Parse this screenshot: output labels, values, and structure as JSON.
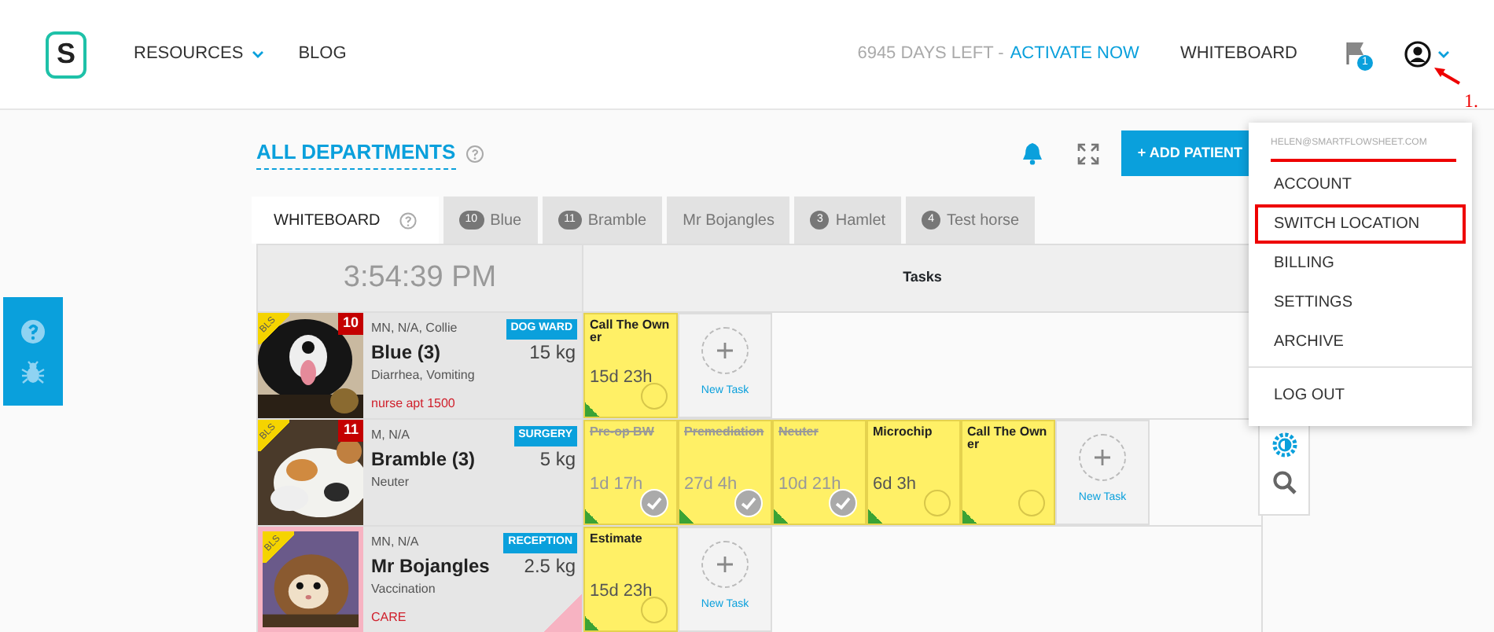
{
  "navbar": {
    "logo": "S",
    "items": [
      {
        "label": "RESOURCES",
        "dropdown": true
      },
      {
        "label": "BLOG",
        "dropdown": false
      }
    ],
    "trial_text": "6945 DAYS LEFT -",
    "trial_link": "ACTIVATE NOW",
    "whiteboard": "WHITEBOARD",
    "flag_count": "1"
  },
  "header": {
    "title": "ALL DEPARTMENTS",
    "add_button": "+ ADD PATIENT"
  },
  "tabs": [
    {
      "label": "WHITEBOARD",
      "selected": true,
      "help": true
    },
    {
      "label": "Blue",
      "count": "10",
      "selected": false
    },
    {
      "label": "Bramble",
      "count": "11",
      "selected": false
    },
    {
      "label": "Mr Bojangles",
      "selected": false
    },
    {
      "label": "Hamlet",
      "count": "3",
      "selected": false
    },
    {
      "label": "Test horse",
      "count": "4",
      "selected": false
    }
  ],
  "board": {
    "clock": "3:54:39 PM",
    "tasks_heading": "Tasks",
    "patients": [
      {
        "number": "10",
        "tag": "BLS",
        "details": "MN, N/A, Collie",
        "name": "Blue (3)",
        "ward": "DOG WARD",
        "weight": "15 kg",
        "problem": "Diarrhea, Vomiting",
        "note": "nurse apt 1500",
        "highlighted": false,
        "new_task": "New Task",
        "tasks": [
          {
            "title": "Call The Owner",
            "due": "15d 23h",
            "done": false
          }
        ]
      },
      {
        "number": "11",
        "tag": "BLS",
        "details": "M, N/A",
        "name": "Bramble (3)",
        "ward": "SURGERY",
        "weight": "5 kg",
        "problem": "Neuter",
        "highlighted": false,
        "new_task": "New Task",
        "tasks": [
          {
            "title": "Pre-op BW",
            "due": "1d 17h",
            "done": true
          },
          {
            "title": "Premediation",
            "due": "27d 4h",
            "done": true
          },
          {
            "title": "Neuter",
            "due": "10d 21h",
            "done": true
          },
          {
            "title": "Microchip",
            "due": "6d 3h",
            "done": false
          },
          {
            "title": "Call The Owner",
            "done": false
          }
        ]
      },
      {
        "tag": "BLS",
        "details": "MN, N/A",
        "name": "Mr Bojangles",
        "ward": "RECEPTION",
        "weight": "2.5 kg",
        "problem": "Vaccination",
        "note": "CARE",
        "highlighted": true,
        "new_task": "New Task",
        "tasks": [
          {
            "title": "Estimate",
            "due": "15d 23h",
            "done": false
          }
        ]
      }
    ]
  },
  "user_menu": {
    "email": "HELEN@SMARTFLOWSHEET.COM",
    "email_marked": true,
    "items": [
      {
        "label": "ACCOUNT",
        "marked": false
      },
      {
        "label": "SWITCH LOCATION",
        "marked": true
      },
      {
        "label": "BILLING",
        "marked": false
      },
      {
        "label": "SETTINGS",
        "marked": false
      },
      {
        "label": "ARCHIVE",
        "marked": false
      }
    ],
    "logout": "LOG OUT"
  },
  "annotation": {
    "label": "1."
  }
}
